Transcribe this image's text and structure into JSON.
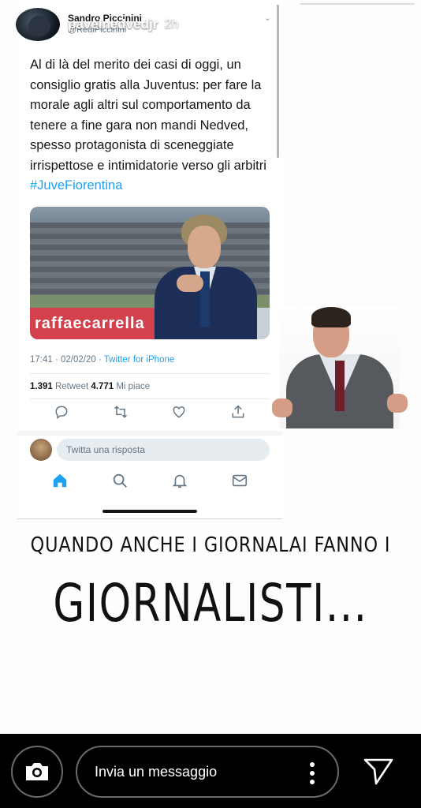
{
  "story": {
    "progress": 0.72,
    "username": "pavelnedvedjr",
    "time": "2h"
  },
  "tweet": {
    "author": "Sandro Piccinini",
    "handle": "@RealPiccinini",
    "text": "Al di là del merito dei casi di oggi, un consiglio gratis alla Juventus: per fare la morale agli altri sul comportamento da tenere a fine gara non mandi Nedved, spesso protagonista di sceneggiate irrispettose e intimidatorie verso gli arbitri",
    "hashtag": "#JuveFiorentina",
    "photo_banner": "raffaecarrella",
    "timestamp": "17:41 · 02/02/20 · ",
    "source": "Twitter for iPhone",
    "retweets_count": "1.391",
    "retweets_label": " Retweet   ",
    "likes_count": "4.771",
    "likes_label": " Mi piace",
    "reply_placeholder": "Twitta una risposta"
  },
  "caption": {
    "line1": "QUANDO ANCHE I GIORNALAI FANNO I",
    "line2": "GIORNALISTI..."
  },
  "reply_bar": {
    "placeholder": "Invia un messaggio"
  },
  "colors": {
    "twitter_blue": "#1da1f2",
    "caption": "#111111"
  }
}
